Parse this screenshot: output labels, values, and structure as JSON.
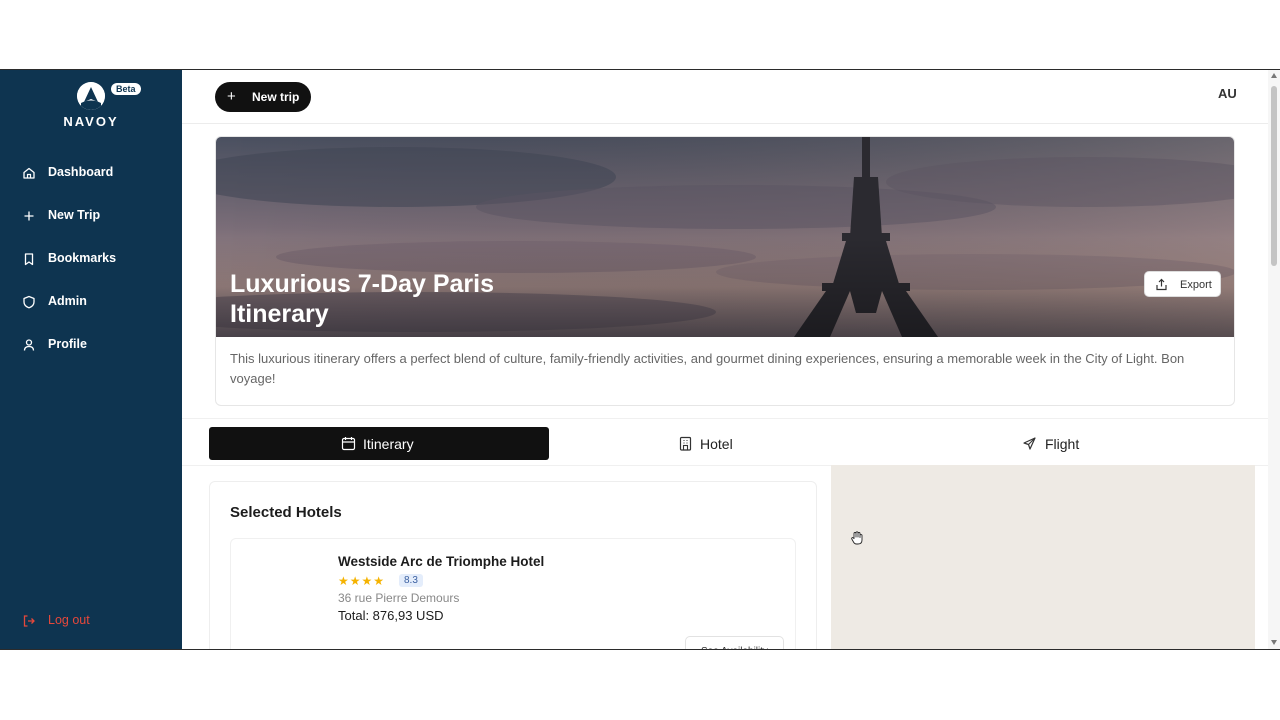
{
  "brand": {
    "name": "NAVOY",
    "badge": "Beta"
  },
  "sidebar": {
    "items": [
      {
        "label": "Dashboard",
        "icon": "home-icon"
      },
      {
        "label": "New Trip",
        "icon": "plus-icon"
      },
      {
        "label": "Bookmarks",
        "icon": "bookmark-icon"
      },
      {
        "label": "Admin",
        "icon": "shield-icon"
      },
      {
        "label": "Profile",
        "icon": "user-icon"
      }
    ],
    "logout": {
      "label": "Log out",
      "icon": "logout-icon"
    }
  },
  "header": {
    "new_trip_label": "New trip",
    "avatar_initials": "AU"
  },
  "trip": {
    "title": "Luxurious 7-Day Paris Itinerary",
    "export_label": "Export",
    "description": "This luxurious itinerary offers a perfect blend of culture, family-friendly activities, and gourmet dining experiences, ensuring a memorable week in the City of Light. Bon voyage!"
  },
  "tabs": [
    {
      "label": "Itinerary",
      "icon": "calendar-icon",
      "active": true
    },
    {
      "label": "Hotel",
      "icon": "building-icon",
      "active": false
    },
    {
      "label": "Flight",
      "icon": "plane-icon",
      "active": false
    }
  ],
  "hotels": {
    "section_title": "Selected Hotels",
    "items": [
      {
        "name": "Westside Arc de Triomphe Hotel",
        "stars": "★★★★",
        "star_count": 4,
        "rating": "8.3",
        "address": "36 rue Pierre Demours",
        "total": "Total: 876,93 USD",
        "cta": "See Availability"
      }
    ]
  },
  "colors": {
    "sidebar": "#0e3450",
    "accent_dark": "#111111",
    "logout": "#e5483b",
    "map_bg": "#eeeae4"
  }
}
